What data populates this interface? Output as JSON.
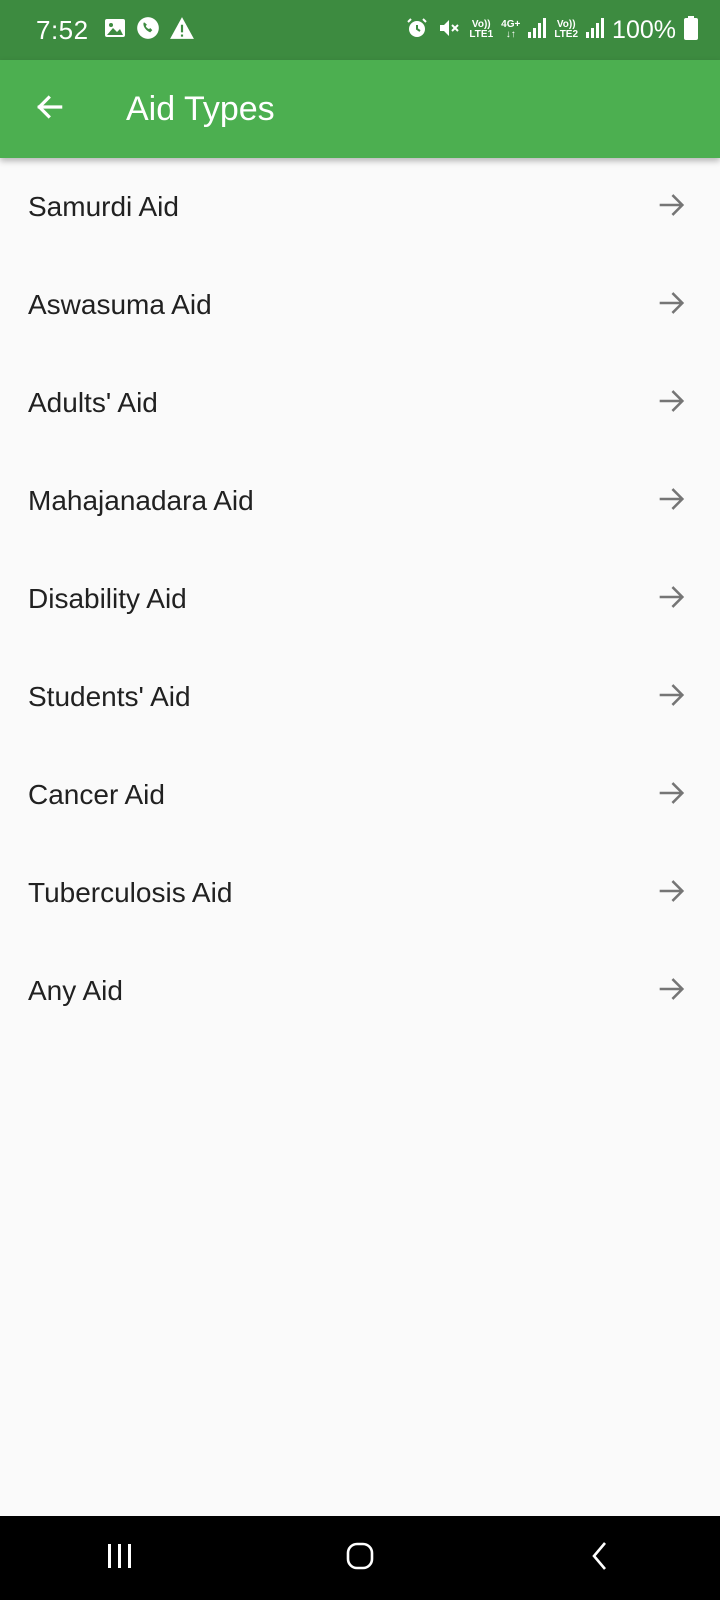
{
  "status_bar": {
    "time": "7:52",
    "sim1_label_top": "Vo))",
    "sim1_label_bottom": "LTE1",
    "network_type": "4G+",
    "sim2_label_top": "Vo))",
    "sim2_label_bottom": "LTE2",
    "battery": "100%",
    "left_icons": [
      "gallery-icon",
      "whatsapp-icon",
      "warning-icon"
    ],
    "right_icons": [
      "alarm-icon",
      "mute-icon",
      "signal-icon",
      "signal-icon",
      "battery-icon"
    ]
  },
  "app_bar": {
    "title": "Aid Types",
    "back_icon": "arrow-back-icon",
    "color": "#4caf50"
  },
  "aid_types": [
    {
      "label": "Samurdi Aid",
      "icon": "arrow-forward-icon"
    },
    {
      "label": "Aswasuma Aid",
      "icon": "arrow-forward-icon"
    },
    {
      "label": "Adults' Aid",
      "icon": "arrow-forward-icon"
    },
    {
      "label": "Mahajanadara Aid",
      "icon": "arrow-forward-icon"
    },
    {
      "label": "Disability Aid",
      "icon": "arrow-forward-icon"
    },
    {
      "label": "Students' Aid",
      "icon": "arrow-forward-icon"
    },
    {
      "label": "Cancer Aid",
      "icon": "arrow-forward-icon"
    },
    {
      "label": "Tuberculosis Aid",
      "icon": "arrow-forward-icon"
    },
    {
      "label": "Any Aid",
      "icon": "arrow-forward-icon"
    }
  ],
  "nav_bar": {
    "buttons": [
      "recent-apps-icon",
      "home-icon",
      "back-icon"
    ]
  }
}
